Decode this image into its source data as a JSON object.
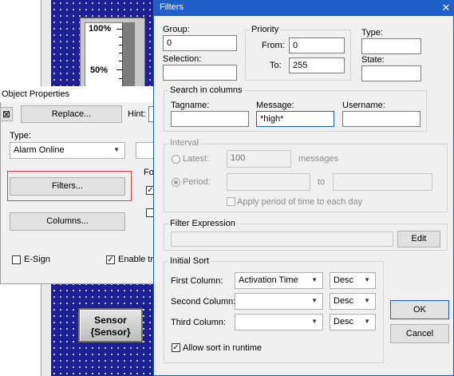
{
  "background": {
    "gauge": {
      "label_top": "100%",
      "label_mid": "50%"
    },
    "sensor_button": {
      "line1": "Sensor",
      "line2": "{Sensor}"
    }
  },
  "object_properties": {
    "title": "Object Properties",
    "replace_label": "Replace...",
    "hint_label": "Hint:",
    "type_label": "Type:",
    "type_value": "Alarm Online",
    "filters_label": "Filters...",
    "fo_label": "Fo",
    "columns_label": "Columns...",
    "esign_label": "E-Sign",
    "enable_label": "Enable tra"
  },
  "filters": {
    "title": "Filters",
    "group_label": "Group:",
    "group_value": "0",
    "selection_label": "Selection:",
    "selection_value": "",
    "priority": {
      "legend": "Priority",
      "from_label": "From:",
      "from_value": "0",
      "to_label": "To:",
      "to_value": "255"
    },
    "type_label": "Type:",
    "state_label": "State:",
    "search": {
      "legend": "Search in columns",
      "tagname_label": "Tagname:",
      "tagname_value": "",
      "message_label": "Message:",
      "message_value": "*high*",
      "username_label": "Username:",
      "username_value": ""
    },
    "interval": {
      "legend": "Interval",
      "latest_label": "Latest:",
      "latest_value": "100",
      "messages_label": "messages",
      "period_label": "Period:",
      "to_label": "to",
      "apply_label": "Apply period of time to each day"
    },
    "filter_expression": {
      "legend": "Filter Expression",
      "value": "",
      "edit_label": "Edit"
    },
    "initial_sort": {
      "legend": "Initial Sort",
      "first_label": "First Column:",
      "first_value": "Activation Time",
      "first_order": "Desc",
      "second_label": "Second Column:",
      "second_value": "",
      "second_order": "Desc",
      "third_label": "Third Column:",
      "third_value": "",
      "third_order": "Desc",
      "allow_sort_label": "Allow sort in runtime"
    },
    "ok_label": "OK",
    "cancel_label": "Cancel"
  }
}
